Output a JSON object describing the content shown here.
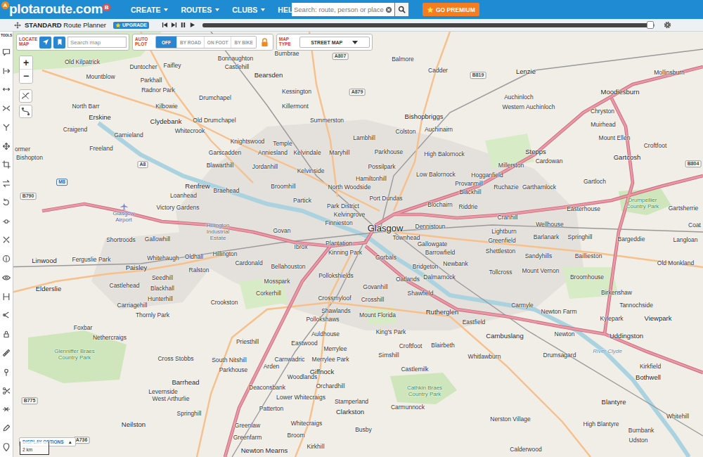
{
  "header": {
    "logo": "plotaroute.com",
    "logo_badges": [
      "A",
      "B"
    ],
    "menu": [
      {
        "label": "CREATE"
      },
      {
        "label": "ROUTES"
      },
      {
        "label": "CLUBS"
      },
      {
        "label": "HELP"
      }
    ],
    "search": {
      "placeholder": "Search: route, person or place"
    },
    "premium": {
      "label": "GO PREMIUM"
    }
  },
  "planner_bar": {
    "edition": "STANDARD",
    "title": "Route Planner",
    "upgrade": "UPGRADE",
    "progress": {
      "level": 0.99
    }
  },
  "tools": {
    "label": "TOOLS"
  },
  "locate": {
    "label": "LOCATE MAP",
    "search_placeholder": "Search map"
  },
  "auto_plot": {
    "label": "AUTO PLOT",
    "options": [
      {
        "label": "OFF",
        "selected": true
      },
      {
        "label": "BY ROAD",
        "selected": false
      },
      {
        "label": "ON FOOT",
        "selected": false
      },
      {
        "label": "BY BIKE",
        "selected": false
      }
    ]
  },
  "map_type": {
    "label": "MAP TYPE",
    "value": "STREET MAP"
  },
  "zoom": {
    "in": "+",
    "out": "−"
  },
  "display_options": {
    "label": "DISPLAY OPTIONS",
    "caret": "▲"
  },
  "scale": {
    "label": "2 km"
  },
  "places": [
    {
      "name": "Burnbrae",
      "kind": "village"
    },
    {
      "name": "A807",
      "kind": "road"
    },
    {
      "name": "Balmore",
      "kind": "village"
    },
    {
      "name": "Bonnaughton",
      "kind": "village"
    },
    {
      "name": "Old Kilpatrick",
      "kind": "village"
    },
    {
      "name": "Faifley",
      "kind": "village"
    },
    {
      "name": "Duntocher",
      "kind": "village"
    },
    {
      "name": "Castlehill",
      "kind": "village"
    },
    {
      "name": "Cadder",
      "kind": "village"
    },
    {
      "name": "Lenzie",
      "kind": "town"
    },
    {
      "name": "Mollinsburn",
      "kind": "village"
    },
    {
      "name": "Bearsden",
      "kind": "town"
    },
    {
      "name": "B819",
      "kind": "road"
    },
    {
      "name": "Mountblow",
      "kind": "village"
    },
    {
      "name": "Parkhall",
      "kind": "village"
    },
    {
      "name": "Radnor Park",
      "kind": "village"
    },
    {
      "name": "Kessington",
      "kind": "village"
    },
    {
      "name": "A879",
      "kind": "road"
    },
    {
      "name": "Moodiesburn",
      "kind": "town"
    },
    {
      "name": "Auchinloch",
      "kind": "village"
    },
    {
      "name": "Drumchapel",
      "kind": "village"
    },
    {
      "name": "North Barr",
      "kind": "village"
    },
    {
      "name": "Kilbowie",
      "kind": "village"
    },
    {
      "name": "Killermont",
      "kind": "village"
    },
    {
      "name": "Western Auchinloch",
      "kind": "village"
    },
    {
      "name": "Chryston",
      "kind": "village"
    },
    {
      "name": "Erskine",
      "kind": "town"
    },
    {
      "name": "Bishopbriggs",
      "kind": "town"
    },
    {
      "name": "Summerston",
      "kind": "village"
    },
    {
      "name": "Clydebank",
      "kind": "town"
    },
    {
      "name": "Old Drumchapel",
      "kind": "village"
    },
    {
      "name": "Muirhead",
      "kind": "village"
    },
    {
      "name": "Craigend",
      "kind": "village"
    },
    {
      "name": "Auchinairn",
      "kind": "village"
    },
    {
      "name": "Colston",
      "kind": "village"
    },
    {
      "name": "Whitecrook",
      "kind": "village"
    },
    {
      "name": "Garnieland",
      "kind": "village"
    },
    {
      "name": "Mount Ellen",
      "kind": "village"
    },
    {
      "name": "Lambhill",
      "kind": "village"
    },
    {
      "name": "Knightswood",
      "kind": "village"
    },
    {
      "name": "Temple",
      "kind": "village"
    },
    {
      "name": "Croftfoot",
      "kind": "village"
    },
    {
      "name": "ormer",
      "kind": "village"
    },
    {
      "name": "Bishopton",
      "kind": "village"
    },
    {
      "name": "Freeland",
      "kind": "village"
    },
    {
      "name": "Stepps",
      "kind": "town"
    },
    {
      "name": "Parkhouse",
      "kind": "village"
    },
    {
      "name": "Garscadden",
      "kind": "village"
    },
    {
      "name": "Anniesland",
      "kind": "village"
    },
    {
      "name": "Kelvindale",
      "kind": "village"
    },
    {
      "name": "Maryhill",
      "kind": "village"
    },
    {
      "name": "High Balornock",
      "kind": "village"
    },
    {
      "name": "Gartcosh",
      "kind": "town"
    },
    {
      "name": "Cardowan",
      "kind": "village"
    },
    {
      "name": "B804",
      "kind": "road"
    },
    {
      "name": "Millerston",
      "kind": "village"
    },
    {
      "name": "A8",
      "kind": "road"
    },
    {
      "name": "Blawarthill",
      "kind": "village"
    },
    {
      "name": "Jordanhill",
      "kind": "village"
    },
    {
      "name": "Kelvinside",
      "kind": "village"
    },
    {
      "name": "Possilpark",
      "kind": "village"
    },
    {
      "name": "Low Balornock",
      "kind": "village"
    },
    {
      "name": "Hogganfield",
      "kind": "village"
    },
    {
      "name": "Hamiltonhill",
      "kind": "village"
    },
    {
      "name": "Gartloch",
      "kind": "village"
    },
    {
      "name": "M8",
      "kind": "motorway"
    },
    {
      "name": "Provanmill",
      "kind": "village"
    },
    {
      "name": "Renfrew",
      "kind": "town"
    },
    {
      "name": "Broomhill",
      "kind": "village"
    },
    {
      "name": "North Woodside",
      "kind": "village"
    },
    {
      "name": "Ruchazie",
      "kind": "village"
    },
    {
      "name": "Garthamlock",
      "kind": "village"
    },
    {
      "name": "Braehead",
      "kind": "village"
    },
    {
      "name": "Blackhill",
      "kind": "village"
    },
    {
      "name": "B790",
      "kind": "road"
    },
    {
      "name": "Loanhead",
      "kind": "village"
    },
    {
      "name": "Port Dundas",
      "kind": "village"
    },
    {
      "name": "Partick",
      "kind": "village"
    },
    {
      "name": "Drumpellier Country Park",
      "kind": "park"
    },
    {
      "name": "Blochairn",
      "kind": "village"
    },
    {
      "name": "Park District",
      "kind": "village"
    },
    {
      "name": "Riddrie",
      "kind": "village"
    },
    {
      "name": "Victory Gardens",
      "kind": "village"
    },
    {
      "name": "Gartsherrie",
      "kind": "village"
    },
    {
      "name": "Easterhouse",
      "kind": "village"
    },
    {
      "name": "Kelvingrove",
      "kind": "village"
    },
    {
      "name": "Glasgow Airport",
      "kind": "airport"
    },
    {
      "name": "Cranhill",
      "kind": "village"
    },
    {
      "name": "Finnieston",
      "kind": "village"
    },
    {
      "name": "Wellhouse",
      "kind": "village"
    },
    {
      "name": "Coat",
      "kind": "village"
    },
    {
      "name": "Dennistoun",
      "kind": "village"
    },
    {
      "name": "Glasgow",
      "kind": "city"
    },
    {
      "name": "Govan",
      "kind": "village"
    },
    {
      "name": "Hillington Industrial Estate",
      "kind": "area"
    },
    {
      "name": "Lightburn",
      "kind": "village"
    },
    {
      "name": "Townhead",
      "kind": "village"
    },
    {
      "name": "Barlanark",
      "kind": "village"
    },
    {
      "name": "Springhill",
      "kind": "village"
    },
    {
      "name": "Bargeddie",
      "kind": "village"
    },
    {
      "name": "Gallowhill",
      "kind": "village"
    },
    {
      "name": "Shortroods",
      "kind": "village"
    },
    {
      "name": "Langloan",
      "kind": "village"
    },
    {
      "name": "Greenfield",
      "kind": "village"
    },
    {
      "name": "Plantation",
      "kind": "village"
    },
    {
      "name": "Gallowgate",
      "kind": "village"
    },
    {
      "name": "Ibrox",
      "kind": "village"
    },
    {
      "name": "Shettleston",
      "kind": "village"
    },
    {
      "name": "Kinning Park",
      "kind": "village"
    },
    {
      "name": "Barrowfield",
      "kind": "village"
    },
    {
      "name": "Hillington",
      "kind": "village"
    },
    {
      "name": "Sandyhills",
      "kind": "village"
    },
    {
      "name": "Baillieston",
      "kind": "village"
    },
    {
      "name": "Oldhall",
      "kind": "village"
    },
    {
      "name": "Gorbals",
      "kind": "village"
    },
    {
      "name": "Whitehaugh",
      "kind": "village"
    },
    {
      "name": "Ferguslie Park",
      "kind": "village"
    },
    {
      "name": "Linwood",
      "kind": "town"
    },
    {
      "name": "Cardonald",
      "kind": "village"
    },
    {
      "name": "Old Monkland",
      "kind": "village"
    },
    {
      "name": "Newbank",
      "kind": "village"
    },
    {
      "name": "Bellahouston",
      "kind": "village"
    },
    {
      "name": "Bridgeton",
      "kind": "village"
    },
    {
      "name": "Paisley",
      "kind": "town"
    },
    {
      "name": "Ralston",
      "kind": "village"
    },
    {
      "name": "Mount Vernon",
      "kind": "village"
    },
    {
      "name": "Tollcross",
      "kind": "village"
    },
    {
      "name": "Pollokshields",
      "kind": "village"
    },
    {
      "name": "Broomhouse",
      "kind": "village"
    },
    {
      "name": "Dalmarnock",
      "kind": "village"
    },
    {
      "name": "Seedhill",
      "kind": "village"
    },
    {
      "name": "Oatlands",
      "kind": "village"
    },
    {
      "name": "Mosspark",
      "kind": "village"
    },
    {
      "name": "Castlehead",
      "kind": "village"
    },
    {
      "name": "Govanhill",
      "kind": "village"
    },
    {
      "name": "Elderslie",
      "kind": "town"
    },
    {
      "name": "Blackhall",
      "kind": "village"
    },
    {
      "name": "Birkenshaw",
      "kind": "village"
    },
    {
      "name": "Shawfield",
      "kind": "village"
    },
    {
      "name": "Corkerhill",
      "kind": "village"
    },
    {
      "name": "Crossmyloof",
      "kind": "village"
    },
    {
      "name": "Hunterhill",
      "kind": "village"
    },
    {
      "name": "Crosshill",
      "kind": "village"
    },
    {
      "name": "Crookston",
      "kind": "village"
    },
    {
      "name": "Carriagehill",
      "kind": "village"
    },
    {
      "name": "Carmyle",
      "kind": "village"
    },
    {
      "name": "Tannochside",
      "kind": "village"
    },
    {
      "name": "Shawlands",
      "kind": "village"
    },
    {
      "name": "Rutherglen",
      "kind": "town"
    },
    {
      "name": "Newton Farm",
      "kind": "village"
    },
    {
      "name": "Thornly Park",
      "kind": "village"
    },
    {
      "name": "Mount Florida",
      "kind": "village"
    },
    {
      "name": "Viewpark",
      "kind": "town"
    },
    {
      "name": "Kylepark",
      "kind": "village"
    },
    {
      "name": "Pollokshaws",
      "kind": "village"
    },
    {
      "name": "Eastfield",
      "kind": "village"
    },
    {
      "name": "Foxbar",
      "kind": "village"
    },
    {
      "name": "King's Park",
      "kind": "village"
    },
    {
      "name": "Auldhouse",
      "kind": "village"
    },
    {
      "name": "Newton",
      "kind": "village"
    },
    {
      "name": "Cambuslang",
      "kind": "town"
    },
    {
      "name": "Uddingston",
      "kind": "town"
    },
    {
      "name": "Nethercraigs",
      "kind": "village"
    },
    {
      "name": "Priesthill",
      "kind": "village"
    },
    {
      "name": "Eastwood",
      "kind": "village"
    },
    {
      "name": "Blairbeth",
      "kind": "village"
    },
    {
      "name": "Croftfoot",
      "kind": "village"
    },
    {
      "name": "Merrylee",
      "kind": "village"
    },
    {
      "name": "River Clyde",
      "kind": "water"
    },
    {
      "name": "Glenniffer Braes Country Park",
      "kind": "park"
    },
    {
      "name": "Simshill",
      "kind": "village"
    },
    {
      "name": "Drumsagard",
      "kind": "village"
    },
    {
      "name": "Whitlawburn",
      "kind": "village"
    },
    {
      "name": "Cross Stobbs",
      "kind": "village"
    },
    {
      "name": "Carnwadric",
      "kind": "village"
    },
    {
      "name": "Merrylee Park",
      "kind": "village"
    },
    {
      "name": "South Nitshill",
      "kind": "village"
    },
    {
      "name": "Kirkfield",
      "kind": "village"
    },
    {
      "name": "Arden",
      "kind": "village"
    },
    {
      "name": "Castlemilk",
      "kind": "village"
    },
    {
      "name": "Parkhouse",
      "kind": "village"
    },
    {
      "name": "Giffnock",
      "kind": "town"
    },
    {
      "name": "Woodlands",
      "kind": "village"
    },
    {
      "name": "Bothwell",
      "kind": "town"
    },
    {
      "name": "Barrhead",
      "kind": "town"
    },
    {
      "name": "Orchardhill",
      "kind": "village"
    },
    {
      "name": "Deaconsbank",
      "kind": "village"
    },
    {
      "name": "Cathkin Braes Country Park",
      "kind": "park"
    },
    {
      "name": "Levernside",
      "kind": "village"
    },
    {
      "name": "Lower Whitecraigs",
      "kind": "village"
    },
    {
      "name": "West Arthurlie",
      "kind": "village"
    },
    {
      "name": "B775",
      "kind": "road"
    },
    {
      "name": "Stamperland",
      "kind": "village"
    },
    {
      "name": "Blantyre",
      "kind": "town"
    },
    {
      "name": "Carmunnock",
      "kind": "village"
    },
    {
      "name": "Patterton",
      "kind": "village"
    },
    {
      "name": "Clarkston",
      "kind": "town"
    },
    {
      "name": "Springhill",
      "kind": "village"
    },
    {
      "name": "Whitehill",
      "kind": "village"
    },
    {
      "name": "Nerston Village",
      "kind": "village"
    },
    {
      "name": "Whitecraigs",
      "kind": "village"
    },
    {
      "name": "Neilston",
      "kind": "town"
    },
    {
      "name": "High Blantyre",
      "kind": "village"
    },
    {
      "name": "Greenlaw",
      "kind": "village"
    },
    {
      "name": "Busby",
      "kind": "village"
    },
    {
      "name": "Burnbank",
      "kind": "village"
    },
    {
      "name": "Broom",
      "kind": "village"
    },
    {
      "name": "Greenfarm",
      "kind": "village"
    },
    {
      "name": "A736",
      "kind": "road"
    },
    {
      "name": "Udston",
      "kind": "village"
    },
    {
      "name": "Kirkhill",
      "kind": "village"
    },
    {
      "name": "Calderwood",
      "kind": "village"
    },
    {
      "name": "Newton Mearns",
      "kind": "town"
    }
  ]
}
